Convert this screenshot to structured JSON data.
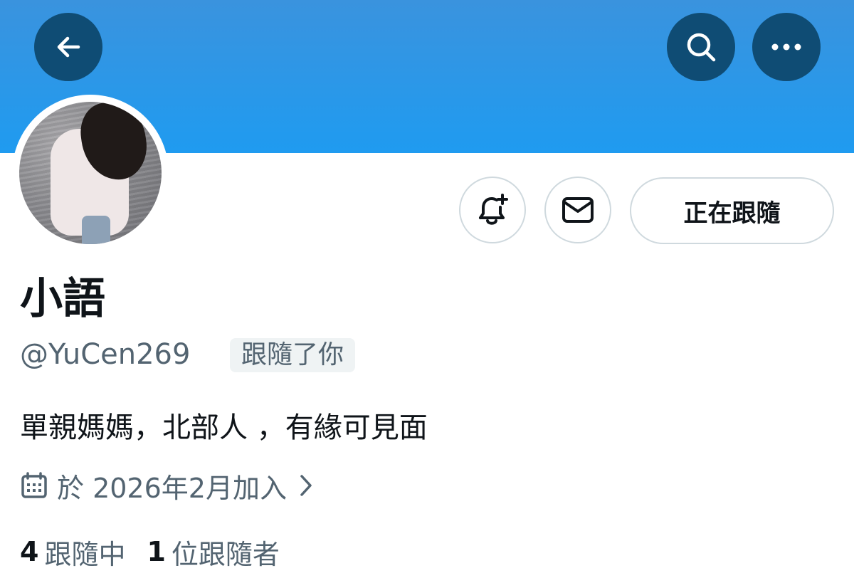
{
  "header": {
    "back_icon": "arrow-left-icon",
    "search_icon": "search-icon",
    "more_icon": "more-horizontal-icon",
    "banner_color": "#1f9bf0",
    "button_color": "#0f4c74"
  },
  "profile": {
    "display_name": "小語",
    "handle": "@YuCen269",
    "follows_you_badge": "跟隨了你",
    "bio": "單親媽媽，北部人 ，有緣可見面",
    "joined": "於 2026年2月加入",
    "following_count": "4",
    "following_label": "跟隨中",
    "followers_count": "1",
    "followers_label": "位跟隨者"
  },
  "actions": {
    "notify_icon": "bell-plus-icon",
    "message_icon": "mail-icon",
    "following_button": "正在跟隨"
  }
}
